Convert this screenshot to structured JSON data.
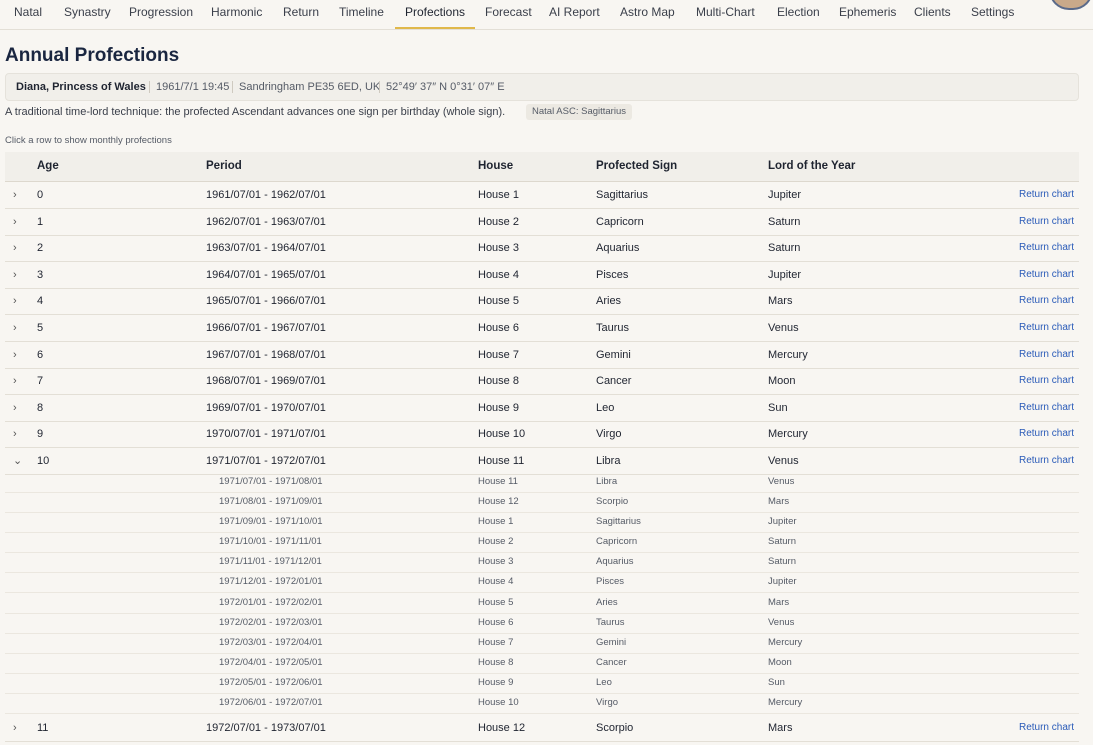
{
  "nav": {
    "tabs": [
      {
        "label": "Natal",
        "active": false
      },
      {
        "label": "Synastry",
        "active": false
      },
      {
        "label": "Progression",
        "active": false
      },
      {
        "label": "Harmonic",
        "active": false
      },
      {
        "label": "Return",
        "active": false
      },
      {
        "label": "Timeline",
        "active": false
      },
      {
        "label": "Profections",
        "active": true
      },
      {
        "label": "Forecast",
        "active": false
      },
      {
        "label": "AI Report",
        "active": false
      },
      {
        "label": "Astro Map",
        "active": false
      },
      {
        "label": "Multi-Chart",
        "active": false
      },
      {
        "label": "Election",
        "active": false
      },
      {
        "label": "Ephemeris",
        "active": false
      },
      {
        "label": "Clients",
        "active": false
      },
      {
        "label": "Settings",
        "active": false
      }
    ]
  },
  "page": {
    "title": "Annual Profections",
    "subject": {
      "name": "Diana, Princess of Wales",
      "datetime": "1961/7/1 19:45",
      "place": "Sandringham PE35 6ED, UK",
      "coords": "52°49′ 37″ N 0°31′ 07″ E"
    },
    "description": "A traditional time-lord technique: the profected Ascendant advances one sign per birthday (whole sign).",
    "natal_asc_badge": "Natal ASC: Sagittarius",
    "hint": "Click a row to show monthly profections"
  },
  "table": {
    "headers": {
      "age": "Age",
      "period": "Period",
      "house": "House",
      "sign": "Profected Sign",
      "lord": "Lord of the Year"
    },
    "return_label": "Return chart",
    "rows": [
      {
        "age": "0",
        "period": "1961/07/01 - 1962/07/01",
        "house": "House 1",
        "sign": "Sagittarius",
        "lord": "Jupiter",
        "expanded": false
      },
      {
        "age": "1",
        "period": "1962/07/01 - 1963/07/01",
        "house": "House 2",
        "sign": "Capricorn",
        "lord": "Saturn",
        "expanded": false
      },
      {
        "age": "2",
        "period": "1963/07/01 - 1964/07/01",
        "house": "House 3",
        "sign": "Aquarius",
        "lord": "Saturn",
        "expanded": false
      },
      {
        "age": "3",
        "period": "1964/07/01 - 1965/07/01",
        "house": "House 4",
        "sign": "Pisces",
        "lord": "Jupiter",
        "expanded": false
      },
      {
        "age": "4",
        "period": "1965/07/01 - 1966/07/01",
        "house": "House 5",
        "sign": "Aries",
        "lord": "Mars",
        "expanded": false
      },
      {
        "age": "5",
        "period": "1966/07/01 - 1967/07/01",
        "house": "House 6",
        "sign": "Taurus",
        "lord": "Venus",
        "expanded": false
      },
      {
        "age": "6",
        "period": "1967/07/01 - 1968/07/01",
        "house": "House 7",
        "sign": "Gemini",
        "lord": "Mercury",
        "expanded": false
      },
      {
        "age": "7",
        "period": "1968/07/01 - 1969/07/01",
        "house": "House 8",
        "sign": "Cancer",
        "lord": "Moon",
        "expanded": false
      },
      {
        "age": "8",
        "period": "1969/07/01 - 1970/07/01",
        "house": "House 9",
        "sign": "Leo",
        "lord": "Sun",
        "expanded": false
      },
      {
        "age": "9",
        "period": "1970/07/01 - 1971/07/01",
        "house": "House 10",
        "sign": "Virgo",
        "lord": "Mercury",
        "expanded": false
      },
      {
        "age": "10",
        "period": "1971/07/01 - 1972/07/01",
        "house": "House 11",
        "sign": "Libra",
        "lord": "Venus",
        "expanded": true
      },
      {
        "age": "11",
        "period": "1972/07/01 - 1973/07/01",
        "house": "House 12",
        "sign": "Scorpio",
        "lord": "Mars",
        "expanded": false
      }
    ],
    "monthly": [
      {
        "period": "1971/07/01 - 1971/08/01",
        "house": "House 11",
        "sign": "Libra",
        "lord": "Venus"
      },
      {
        "period": "1971/08/01 - 1971/09/01",
        "house": "House 12",
        "sign": "Scorpio",
        "lord": "Mars"
      },
      {
        "period": "1971/09/01 - 1971/10/01",
        "house": "House 1",
        "sign": "Sagittarius",
        "lord": "Jupiter"
      },
      {
        "period": "1971/10/01 - 1971/11/01",
        "house": "House 2",
        "sign": "Capricorn",
        "lord": "Saturn"
      },
      {
        "period": "1971/11/01 - 1971/12/01",
        "house": "House 3",
        "sign": "Aquarius",
        "lord": "Saturn"
      },
      {
        "period": "1971/12/01 - 1972/01/01",
        "house": "House 4",
        "sign": "Pisces",
        "lord": "Jupiter"
      },
      {
        "period": "1972/01/01 - 1972/02/01",
        "house": "House 5",
        "sign": "Aries",
        "lord": "Mars"
      },
      {
        "period": "1972/02/01 - 1972/03/01",
        "house": "House 6",
        "sign": "Taurus",
        "lord": "Venus"
      },
      {
        "period": "1972/03/01 - 1972/04/01",
        "house": "House 7",
        "sign": "Gemini",
        "lord": "Mercury"
      },
      {
        "period": "1972/04/01 - 1972/05/01",
        "house": "House 8",
        "sign": "Cancer",
        "lord": "Moon"
      },
      {
        "period": "1972/05/01 - 1972/06/01",
        "house": "House 9",
        "sign": "Leo",
        "lord": "Sun"
      },
      {
        "period": "1972/06/01 - 1972/07/01",
        "house": "House 10",
        "sign": "Virgo",
        "lord": "Mercury"
      }
    ]
  }
}
